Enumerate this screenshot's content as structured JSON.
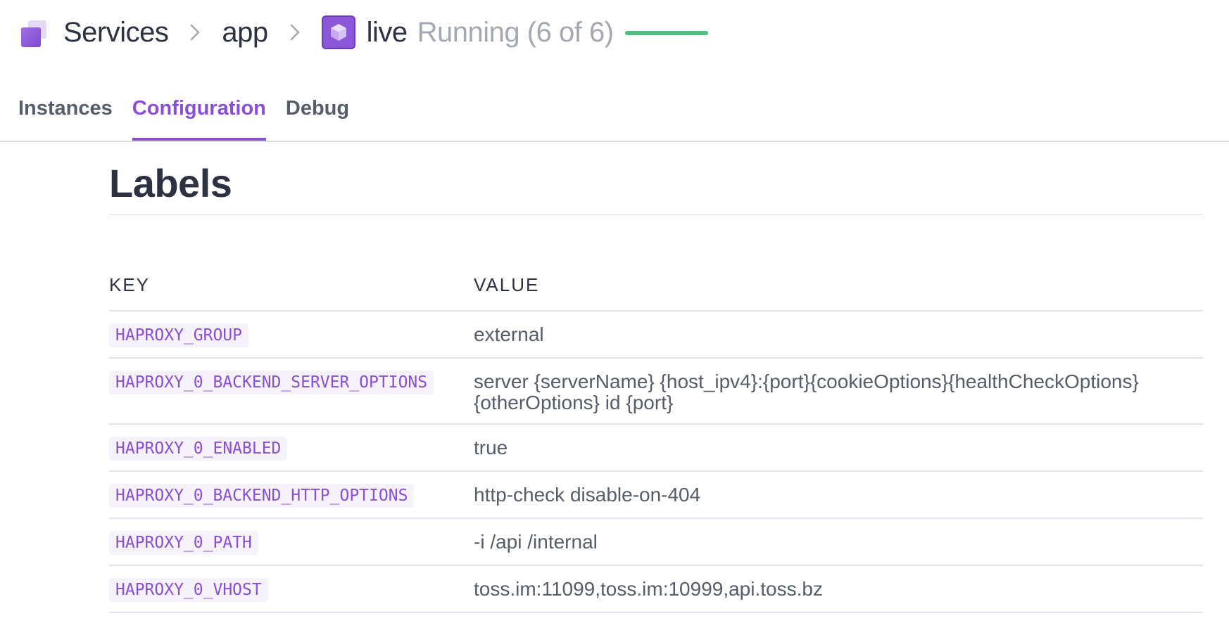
{
  "breadcrumb": {
    "items": [
      {
        "label": "Services"
      },
      {
        "label": "app"
      },
      {
        "label": "live"
      }
    ],
    "status": "Running (6 of 6)",
    "status_fraction": 1.0,
    "status_color": "#4fbf7f"
  },
  "tabs": [
    {
      "label": "Instances",
      "active": false
    },
    {
      "label": "Configuration",
      "active": true
    },
    {
      "label": "Debug",
      "active": false
    }
  ],
  "labels_section": {
    "title": "Labels",
    "columns": {
      "key": "KEY",
      "value": "VALUE"
    },
    "rows": [
      {
        "key": "HAPROXY_GROUP",
        "value": "external"
      },
      {
        "key": "HAPROXY_0_BACKEND_SERVER_OPTIONS",
        "value": "server {serverName} {host_ipv4}:{port}{cookieOptions}{healthCheckOptions}{otherOptions} id {port}"
      },
      {
        "key": "HAPROXY_0_ENABLED",
        "value": "true"
      },
      {
        "key": "HAPROXY_0_BACKEND_HTTP_OPTIONS",
        "value": "http-check disable-on-404"
      },
      {
        "key": "HAPROXY_0_PATH",
        "value": "-i /api /internal"
      },
      {
        "key": "HAPROXY_0_VHOST",
        "value": "toss.im:11099,toss.im:10999,api.toss.bz"
      }
    ]
  },
  "colors": {
    "accent": "#8a4fd6",
    "text_primary": "#2d3142",
    "text_secondary": "#575c6b",
    "muted": "#a4a8b3"
  },
  "icons": {
    "logo": "services-logo-icon",
    "separator": "chevron-right-icon",
    "service": "service-cube-icon"
  }
}
